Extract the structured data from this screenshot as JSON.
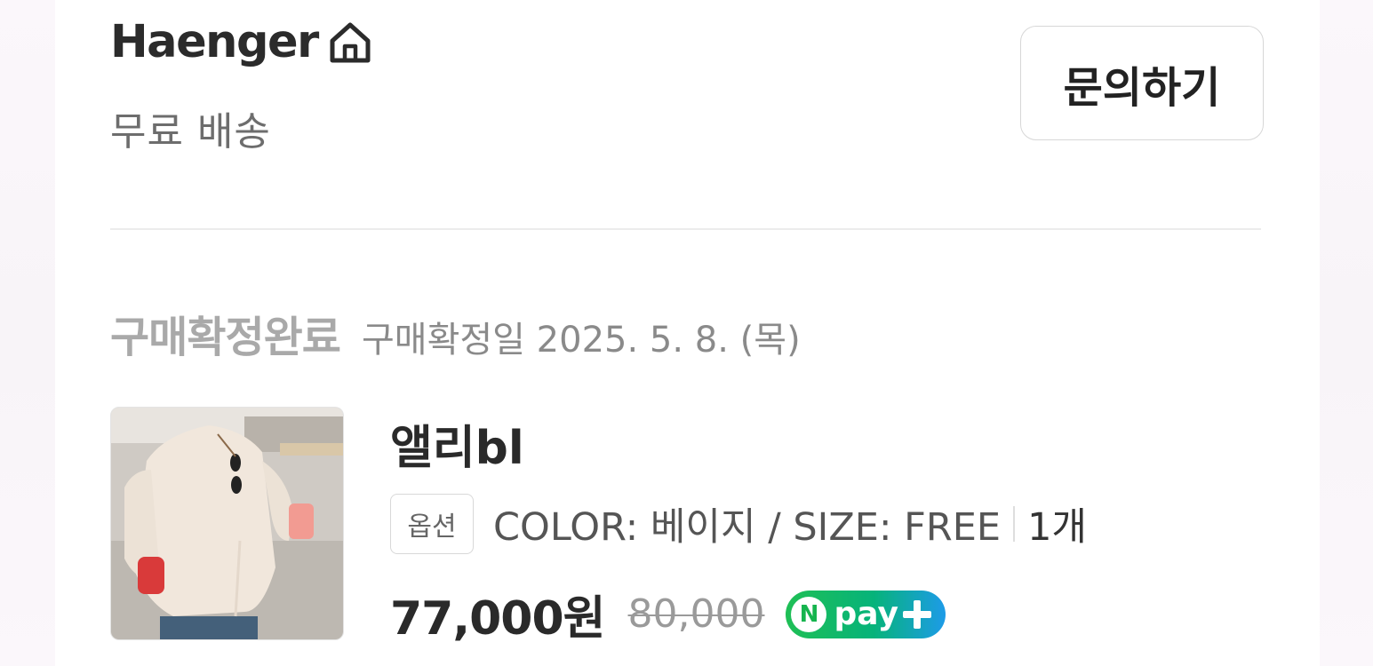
{
  "store": {
    "name": "Haenger",
    "shipping": "무료 배송",
    "inquiry_label": "문의하기"
  },
  "order": {
    "status": "구매확정완료",
    "confirm_date": "구매확정일 2025. 5. 8. (목)"
  },
  "product": {
    "name": "앨리bl",
    "option_badge": "옵션",
    "option_text": "COLOR: 베이지 / SIZE: FREE",
    "quantity": "1개",
    "price": "77,000원",
    "original_price": "80,000",
    "pay_badge": {
      "n": "N",
      "text": "pay",
      "colors": [
        "#1fbf55",
        "#1d9be8"
      ]
    }
  },
  "icons": {
    "home": "home-icon",
    "plus": "plus-icon"
  }
}
